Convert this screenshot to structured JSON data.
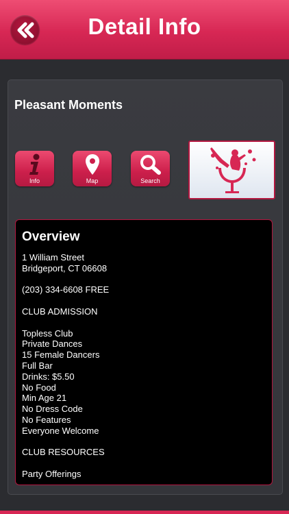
{
  "header": {
    "title": "Detail Info",
    "back_icon": "double-chevron-left-icon"
  },
  "place": {
    "name": "Pleasant Moments"
  },
  "actions": [
    {
      "label": "Info",
      "icon": "info-icon"
    },
    {
      "label": "Map",
      "icon": "map-pin-icon"
    },
    {
      "label": "Search",
      "icon": "magnifier-icon"
    }
  ],
  "photo": {
    "icon": "club-dancer-icon"
  },
  "overview": {
    "title": "Overview",
    "lines": [
      "1 William Street",
      "Bridgeport, CT 06608",
      "",
      "(203) 334-6608 FREE",
      "",
      "CLUB ADMISSION",
      "",
      "Topless Club",
      "Private Dances",
      "15 Female Dancers",
      "Full Bar",
      "Drinks: $5.50",
      "No Food",
      "Min Age 21",
      "No Dress Code",
      "No Features",
      "Everyone Welcome",
      "",
      "CLUB RESOURCES",
      "",
      "Party Offerings"
    ]
  },
  "colors": {
    "accent": "#d72754",
    "background": "#2b2c30",
    "panel": "#38393e",
    "overview_bg": "#000000"
  }
}
